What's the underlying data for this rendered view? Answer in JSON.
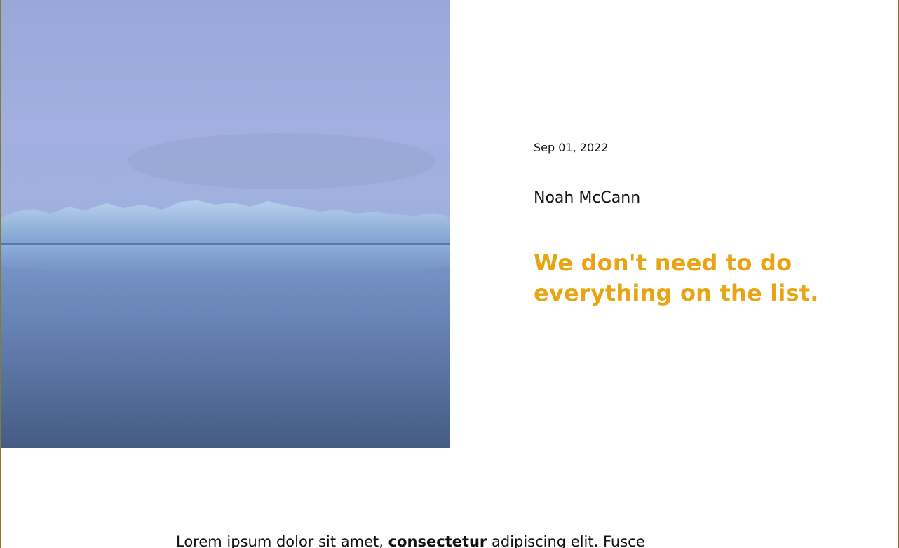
{
  "post": {
    "date": "Sep 01, 2022",
    "author": "Noah McCann",
    "title": "We don't need to do everything on the list.",
    "excerpt": {
      "part1": "Lorem ipsum dolor sit amet, ",
      "bold": "consectetur",
      "part2": " adipiscing elit. Fusce"
    }
  },
  "colors": {
    "accent": "#e8a412",
    "border": "#8a7a2e"
  },
  "image": {
    "subject": "glacier-landscape"
  }
}
